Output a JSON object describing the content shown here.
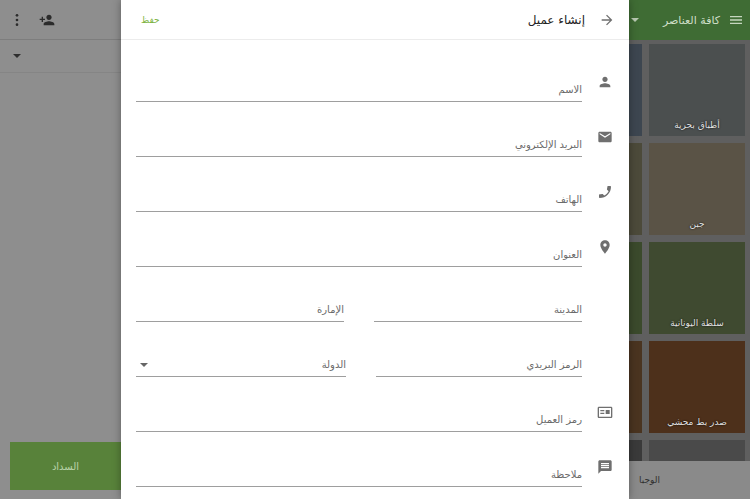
{
  "left_panel": {
    "pay_button": "السداد"
  },
  "items_panel": {
    "title": "كافة العناصر",
    "categories": [
      {
        "label": "أطباق بحرية"
      },
      {
        "label": "جبن"
      },
      {
        "label": "سلطة اليونانية"
      },
      {
        "label": "صدر بط محشي"
      }
    ],
    "bottom_label": "الوجبا"
  },
  "dialog": {
    "title": "إنشاء عميل",
    "save": "حفظ",
    "rows": [
      {
        "fields": [
          {
            "label": "الاسم",
            "kind": "text"
          }
        ]
      },
      {
        "fields": [
          {
            "label": "البريد الإلكتروني",
            "kind": "text"
          }
        ]
      },
      {
        "fields": [
          {
            "label": "الهاتف",
            "kind": "text"
          }
        ]
      },
      {
        "fields": [
          {
            "label": "العنوان",
            "kind": "text"
          }
        ]
      },
      {
        "fields": [
          {
            "label": "المدينة",
            "kind": "text"
          },
          {
            "label": "الإمارة",
            "kind": "text"
          }
        ]
      },
      {
        "fields": [
          {
            "label": "الرمز البريدي",
            "kind": "text"
          },
          {
            "label": "الدولة",
            "kind": "select"
          }
        ]
      },
      {
        "fields": [
          {
            "label": "رمز العميل",
            "kind": "text"
          }
        ]
      },
      {
        "fields": [
          {
            "label": "ملاحظة",
            "kind": "text"
          }
        ]
      }
    ]
  }
}
